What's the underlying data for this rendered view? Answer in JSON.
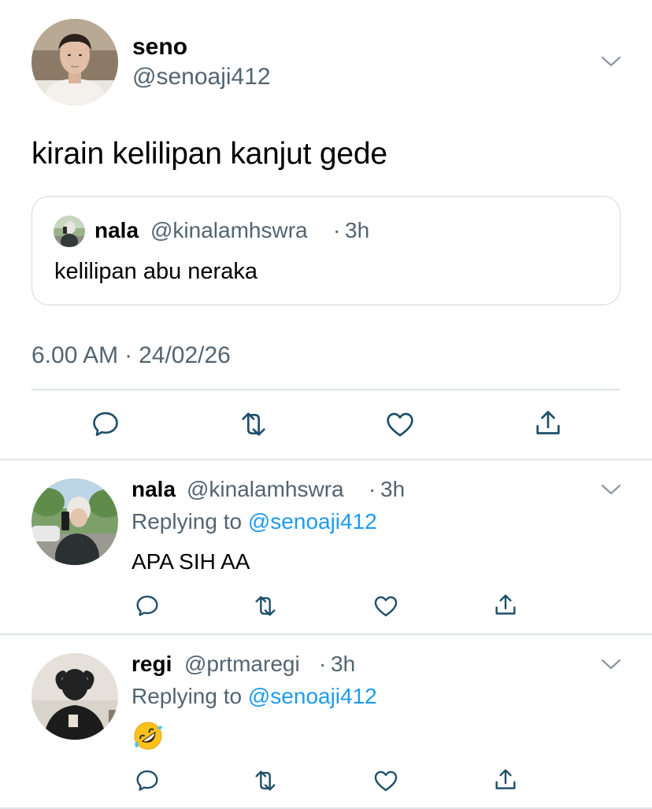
{
  "main_tweet": {
    "name": "seno",
    "handle": "@senoaji412",
    "text": "kirain kelilipan kanjut gede",
    "quoted": {
      "name": "nala",
      "handle": "@kinalamhswra",
      "separator": "·",
      "time": "3h",
      "text": "kelilipan abu neraka"
    },
    "time": "6.00 AM",
    "separator": "·",
    "date": "24/02/26"
  },
  "replies": [
    {
      "name": "nala",
      "handle": "@kinalamhswra",
      "separator": "·",
      "time": "3h",
      "replying_label": "Replying to",
      "replying_to": "@senoaji412",
      "text": "APA SIH AA"
    },
    {
      "name": "regi",
      "handle": "@prtmaregi",
      "separator": "·",
      "time": "3h",
      "replying_label": "Replying to",
      "replying_to": "@senoaji412",
      "emoji": "rolling-on-the-floor-laughing"
    }
  ],
  "icons": {
    "reply": "speech-bubble-icon",
    "retweet": "retweet-arrows-icon",
    "like": "heart-icon",
    "share": "share-upload-icon",
    "more": "chevron-down-icon"
  },
  "colors": {
    "text": "#0f1419",
    "muted": "#536471",
    "link": "#1d9bf0",
    "border": "#cfd9de"
  }
}
